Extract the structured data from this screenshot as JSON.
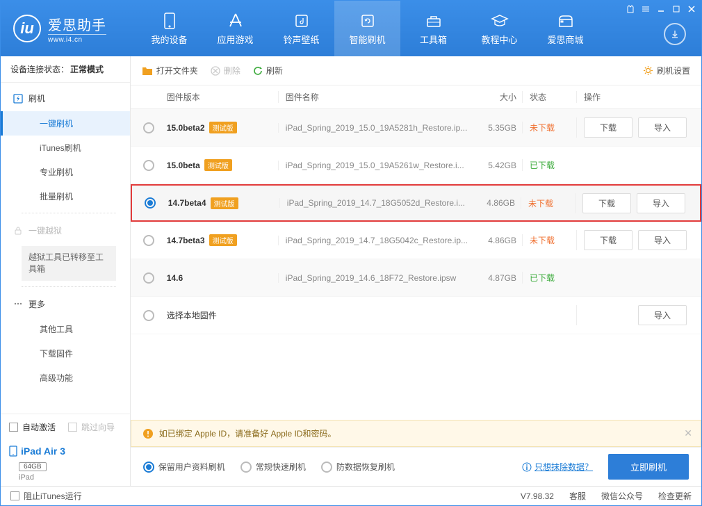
{
  "app": {
    "name": "爱思助手",
    "url": "www.i4.cn"
  },
  "nav": {
    "items": [
      {
        "label": "我的设备"
      },
      {
        "label": "应用游戏"
      },
      {
        "label": "铃声壁纸"
      },
      {
        "label": "智能刷机"
      },
      {
        "label": "工具箱"
      },
      {
        "label": "教程中心"
      },
      {
        "label": "爱思商城"
      }
    ]
  },
  "sidebar": {
    "conn_label": "设备连接状态：",
    "conn_value": "正常模式",
    "flash_group": "刷机",
    "subs": [
      {
        "label": "一键刷机"
      },
      {
        "label": "iTunes刷机"
      },
      {
        "label": "专业刷机"
      },
      {
        "label": "批量刷机"
      }
    ],
    "jailbreak": "一键越狱",
    "jailbreak_note": "越狱工具已转移至工具箱",
    "more": "更多",
    "more_items": [
      {
        "label": "其他工具"
      },
      {
        "label": "下载固件"
      },
      {
        "label": "高级功能"
      }
    ],
    "auto_activate": "自动激活",
    "skip_guide": "跳过向导",
    "device_name": "iPad Air 3",
    "storage": "64GB",
    "device_type": "iPad"
  },
  "toolbar": {
    "open": "打开文件夹",
    "delete": "删除",
    "refresh": "刷新",
    "settings": "刷机设置"
  },
  "table": {
    "headers": {
      "version": "固件版本",
      "name": "固件名称",
      "size": "大小",
      "status": "状态",
      "ops": "操作"
    },
    "btn_download": "下载",
    "btn_import": "导入",
    "status_notdl": "未下载",
    "status_dl": "已下载",
    "tag_beta": "测试版",
    "select_local": "选择本地固件",
    "rows": [
      {
        "ver": "15.0beta2",
        "beta": true,
        "name": "iPad_Spring_2019_15.0_19A5281h_Restore.ip...",
        "size": "5.35GB",
        "status": "nd",
        "ops": [
          "dl",
          "im"
        ]
      },
      {
        "ver": "15.0beta",
        "beta": true,
        "name": "iPad_Spring_2019_15.0_19A5261w_Restore.i...",
        "size": "5.42GB",
        "status": "dl",
        "ops": []
      },
      {
        "ver": "14.7beta4",
        "beta": true,
        "name": "iPad_Spring_2019_14.7_18G5052d_Restore.i...",
        "size": "4.86GB",
        "status": "nd",
        "ops": [
          "dl",
          "im"
        ],
        "selected": true,
        "highlight": true
      },
      {
        "ver": "14.7beta3",
        "beta": true,
        "name": "iPad_Spring_2019_14.7_18G5042c_Restore.ip...",
        "size": "4.86GB",
        "status": "nd",
        "ops": [
          "dl",
          "im"
        ]
      },
      {
        "ver": "14.6",
        "beta": false,
        "name": "iPad_Spring_2019_14.6_18F72_Restore.ipsw",
        "size": "4.87GB",
        "status": "dl",
        "ops": []
      }
    ]
  },
  "alert": {
    "text": "如已绑定 Apple ID，请准备好 Apple ID和密码。"
  },
  "modes": {
    "opts": [
      "保留用户资料刷机",
      "常规快速刷机",
      "防数据恢复刷机"
    ],
    "erase_link": "只想抹除数据？",
    "go": "立即刷机"
  },
  "footer": {
    "block_itunes": "阻止iTunes运行",
    "version": "V7.98.32",
    "items": [
      "客服",
      "微信公众号",
      "检查更新"
    ]
  }
}
